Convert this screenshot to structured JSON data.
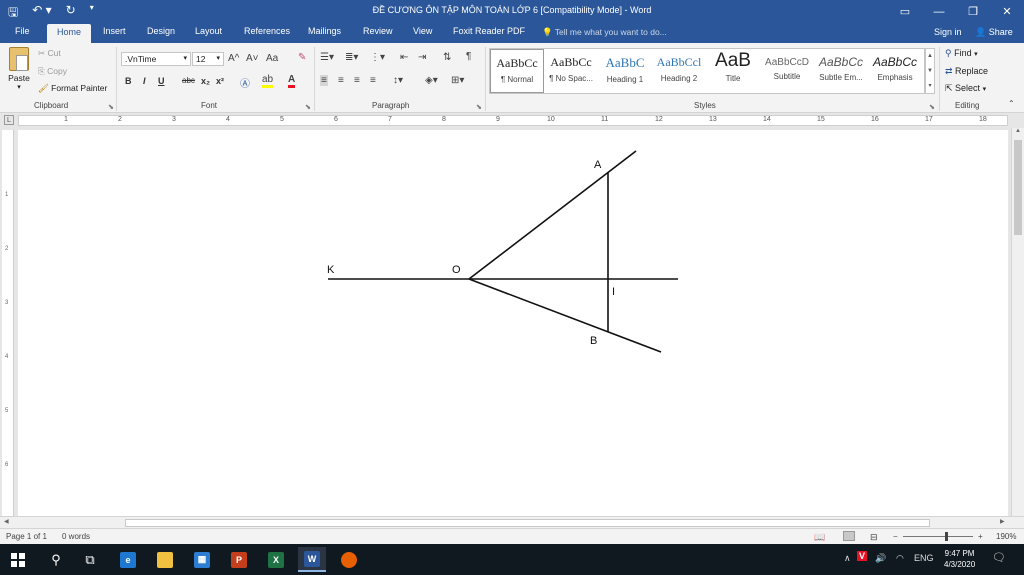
{
  "window": {
    "title": "ĐỀ CƯƠNG ÔN TẬP MÔN TOÁN LỚP 6 [Compatibility Mode] - Word"
  },
  "tabs": [
    "File",
    "Home",
    "Insert",
    "Design",
    "Layout",
    "References",
    "Mailings",
    "Review",
    "View",
    "Foxit Reader PDF"
  ],
  "active_tab": "Home",
  "tell_me": "Tell me what you want to do...",
  "account": {
    "sign_in": "Sign in",
    "share": "Share"
  },
  "clipboard": {
    "paste": "Paste",
    "cut": "Cut",
    "copy": "Copy",
    "format_painter": "Format Painter",
    "label": "Clipboard"
  },
  "font": {
    "name": ".VnTime",
    "size": "12",
    "label": "Font",
    "bold": "B",
    "italic": "I",
    "underline": "U",
    "strike": "abc",
    "subscript": "x₂",
    "superscript": "x²",
    "grow": "A^",
    "shrink": "A˅",
    "case": "Aa",
    "color_a": "A"
  },
  "paragraph": {
    "label": "Paragraph"
  },
  "styles": {
    "label": "Styles",
    "items": [
      {
        "sample": "AaBbCc",
        "name": "¶ Normal"
      },
      {
        "sample": "AaBbCc",
        "name": "¶ No Spac..."
      },
      {
        "sample": "AaBbC",
        "name": "Heading 1"
      },
      {
        "sample": "AaBbCcl",
        "name": "Heading 2"
      },
      {
        "sample": "AaB",
        "name": "Title"
      },
      {
        "sample": "AaBbCcD",
        "name": "Subtitle"
      },
      {
        "sample": "AaBbCc",
        "name": "Subtle Em..."
      },
      {
        "sample": "AaBbCc",
        "name": "Emphasis"
      }
    ]
  },
  "editing": {
    "find": "Find",
    "replace": "Replace",
    "select": "Select",
    "label": "Editing"
  },
  "ruler": {
    "numbers": [
      "1",
      "1",
      "2",
      "3",
      "4",
      "5",
      "6",
      "7",
      "8",
      "9",
      "10",
      "11",
      "12",
      "13",
      "14",
      "15",
      "16",
      "17",
      "18"
    ],
    "vnumbers": [
      "1",
      "2",
      "3",
      "4",
      "5",
      "6"
    ]
  },
  "diagram": {
    "labels": {
      "k": "K",
      "o": "O",
      "a": "A",
      "b": "B",
      "i": "I"
    }
  },
  "status": {
    "page": "Page 1 of 1",
    "words": "0 words",
    "zoom": "190%"
  },
  "taskbar": {
    "apps": [
      "start",
      "search",
      "task-view",
      "edge",
      "file-explorer",
      "store",
      "powerpoint",
      "excel",
      "word",
      "firefox"
    ],
    "tray": {
      "lang": "ENG"
    },
    "time": "9:47 PM",
    "date": "4/3/2020"
  },
  "colors": {
    "brand": "#2b579a",
    "highlight": "#ffff00",
    "font_color": "#e81123",
    "taskbar": "#101820"
  }
}
